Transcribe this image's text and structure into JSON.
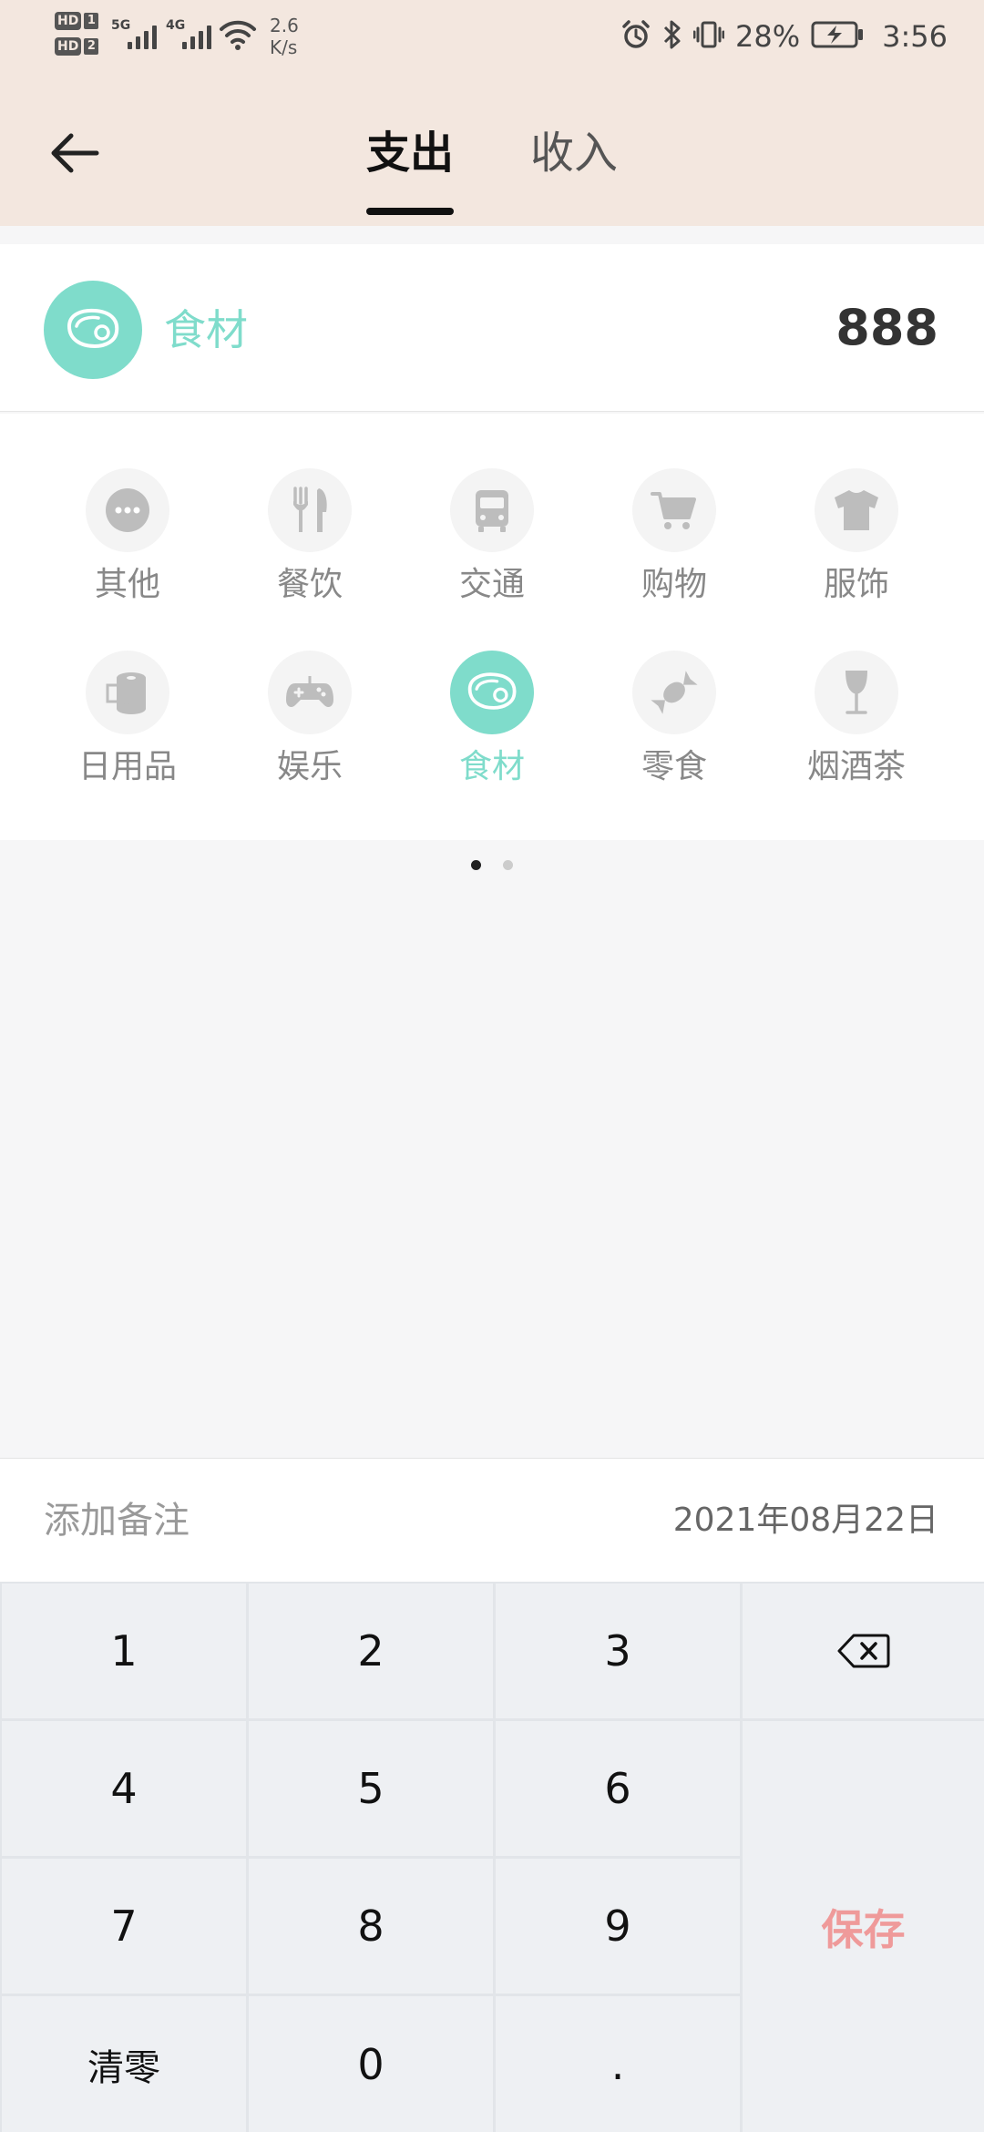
{
  "status_bar": {
    "hd1": "HD",
    "hd1_num": "1",
    "hd2": "HD",
    "hd2_num": "2",
    "net1": "5G",
    "net2": "4G",
    "speed_value": "2.6",
    "speed_unit": "K/s",
    "battery_percent": "28%",
    "time": "3:56"
  },
  "header": {
    "tabs": [
      {
        "label": "支出",
        "active": true
      },
      {
        "label": "收入",
        "active": false
      }
    ]
  },
  "selected_category": {
    "icon": "meat-icon",
    "name": "食材",
    "amount": "888",
    "color": "#7fdccb"
  },
  "categories": [
    {
      "label": "其他",
      "icon": "more-dots-icon"
    },
    {
      "label": "餐饮",
      "icon": "fork-knife-icon"
    },
    {
      "label": "交通",
      "icon": "bus-icon"
    },
    {
      "label": "购物",
      "icon": "cart-icon"
    },
    {
      "label": "服饰",
      "icon": "shirt-icon"
    },
    {
      "label": "日用品",
      "icon": "tissue-roll-icon"
    },
    {
      "label": "娱乐",
      "icon": "gamepad-icon"
    },
    {
      "label": "食材",
      "icon": "meat-icon",
      "selected": true
    },
    {
      "label": "零食",
      "icon": "candy-icon"
    },
    {
      "label": "烟酒茶",
      "icon": "wine-glass-icon"
    }
  ],
  "pager": {
    "pages": 2,
    "current": 1
  },
  "note": {
    "placeholder": "添加备注",
    "date": "2021年08月22日"
  },
  "keypad": {
    "keys": [
      "1",
      "2",
      "3",
      "4",
      "5",
      "6",
      "7",
      "8",
      "9",
      "清零",
      "0",
      "."
    ],
    "backspace_icon": "backspace-icon",
    "save_label": "保存",
    "save_color": "#ef9a9a"
  }
}
